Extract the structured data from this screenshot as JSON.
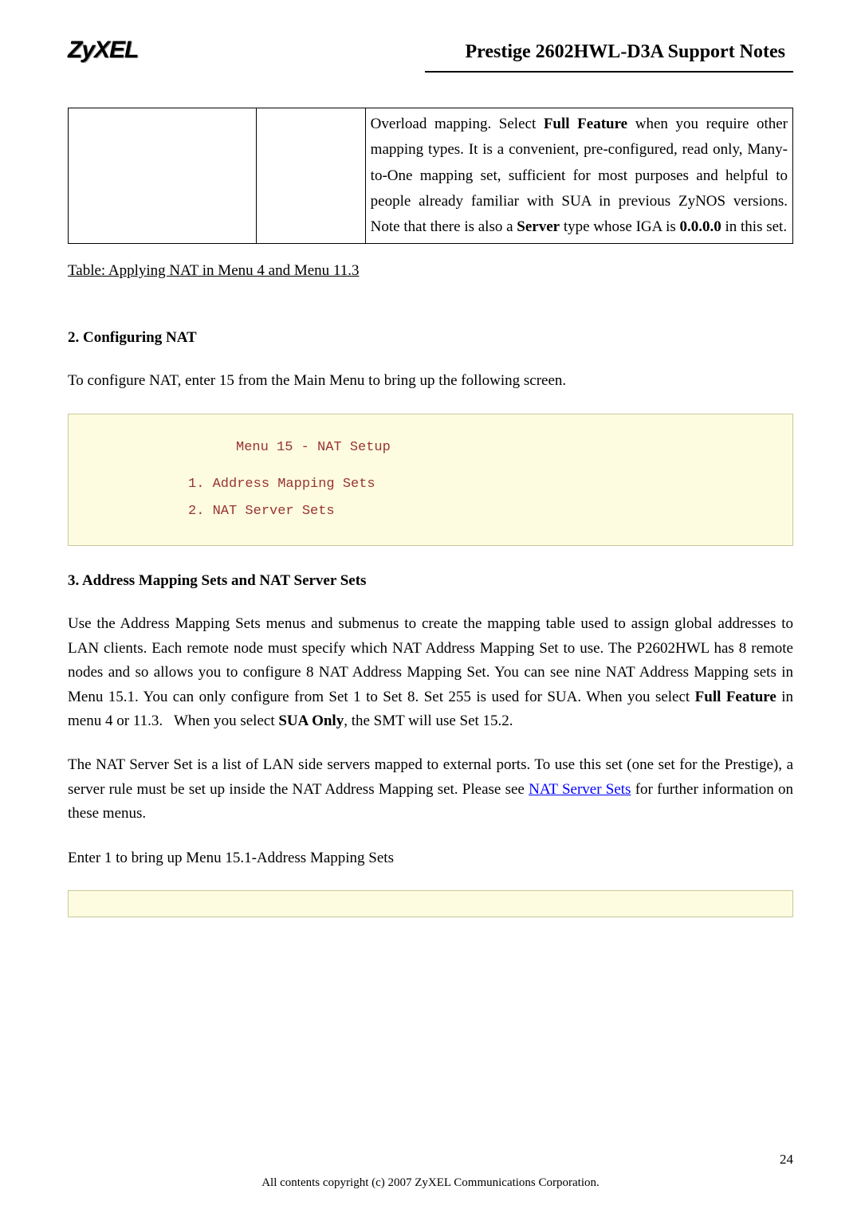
{
  "header": {
    "logo": "ZyXEL",
    "title": "Prestige 2602HWL-D3A Support Notes"
  },
  "table_row": {
    "col1": "",
    "col2": "",
    "col3": "Overload mapping. Select Full Feature when you require other mapping types. It is a convenient, pre-configured, read only, Many-to-One mapping set, sufficient for most purposes and helpful to people already familiar with SUA in previous ZyNOS versions. Note that there is also a Server type whose IGA is 0.0.0.0 in this set."
  },
  "table_caption": "Table: Applying NAT in Menu 4 and Menu 11.3",
  "section2": {
    "heading": "2. Configuring NAT",
    "body": "To configure NAT, enter 15 from the Main Menu to bring up the following screen."
  },
  "menu15": {
    "title": "Menu 15 - NAT Setup",
    "item1": "1. Address Mapping Sets",
    "item2": "2. NAT Server Sets"
  },
  "section3": {
    "heading": "3. Address Mapping Sets and NAT Server Sets",
    "p1": "Use the Address Mapping Sets menus and submenus to create the mapping table used to assign global addresses to LAN clients. Each remote node must specify which NAT Address Mapping Set to use. The P2602HWL has 8 remote nodes and so allows you to configure 8 NAT Address Mapping Set. You can see nine NAT Address Mapping sets in Menu 15.1. You can only configure from Set 1 to Set 8. Set 255 is used for SUA. When you select Full Feature in menu 4 or 11.3.   When you select SUA Only, the SMT will use Set 15.2.",
    "p2_pre": "The NAT Server Set is a list of LAN side servers mapped to external ports. To use this set (one set for the Prestige), a server rule must be set up inside the NAT Address Mapping set. Please see ",
    "p2_link": "NAT Server Sets",
    "p2_post": " for further information on these menus.",
    "p3": "Enter 1 to bring up Menu 15.1-Address Mapping Sets"
  },
  "footer": {
    "page": "24",
    "copyright": "All contents copyright (c) 2007 ZyXEL Communications Corporation."
  }
}
